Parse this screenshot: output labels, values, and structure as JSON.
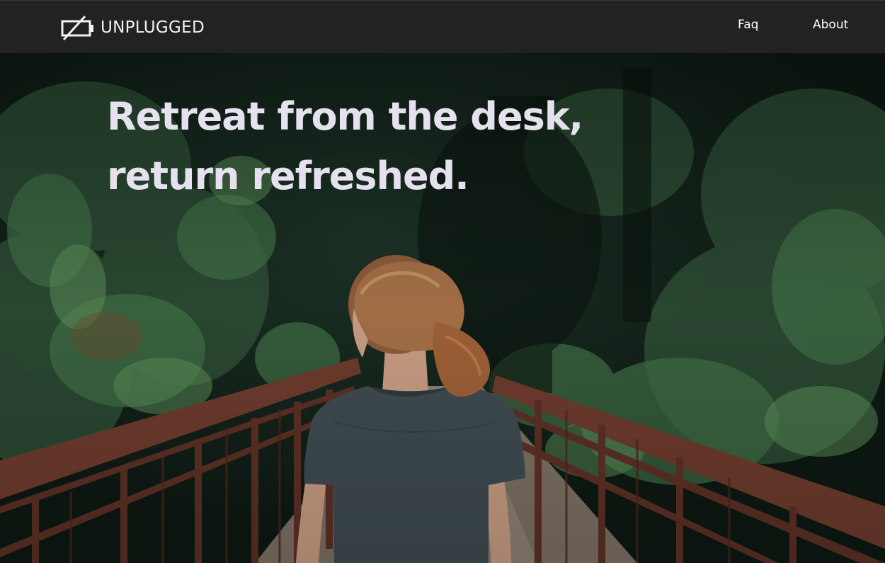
{
  "brand": {
    "name": "UNPLUGGED",
    "logo_icon": "unplugged-battery-icon"
  },
  "nav": {
    "links": [
      {
        "label": "Faq"
      },
      {
        "label": "About"
      }
    ]
  },
  "hero": {
    "headline_line1": "Retreat from the desk,",
    "headline_line2": "return refreshed.",
    "background_image": "woman-on-bridge-in-forest"
  },
  "colors": {
    "navbar_bg": "#222222",
    "nav_text": "#ffffff",
    "headline_text": "#e6e1ee",
    "forest_dark": "#12201a",
    "bridge_rust": "#6b3a2c"
  }
}
